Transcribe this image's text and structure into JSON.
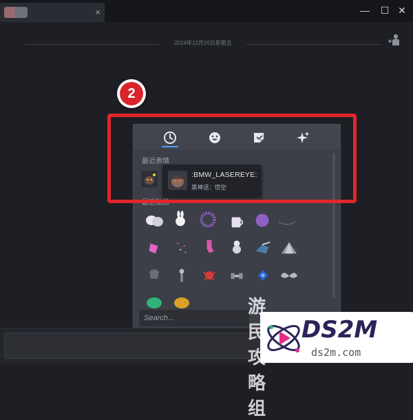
{
  "window": {
    "tab_close": "×",
    "min_label": "—",
    "max_label": "☐",
    "close_label": "✕"
  },
  "chat": {
    "date_divider": "2024年12月20日星期五"
  },
  "callout": {
    "step_number": "2"
  },
  "emoji_panel": {
    "tabs": [
      {
        "icon": "clock-icon",
        "active": true
      },
      {
        "icon": "smiley-icon",
        "active": false
      },
      {
        "icon": "sticker-icon",
        "active": false
      },
      {
        "icon": "sparkle-icon",
        "active": false
      }
    ],
    "recent_emoticons_label": "最近表情",
    "recent_stickers_label": "最近贴纸",
    "search_placeholder": "Search...",
    "accent_color": "#4aa3ff"
  },
  "tooltip": {
    "name": ":BMW_LASEREYE:",
    "source": "黑神话：悟空"
  },
  "highlight": {
    "color": "#e2262c"
  },
  "watermark": {
    "site_cn": "游民攻略组",
    "brand": "DS2M",
    "domain": "ds2m.com"
  }
}
